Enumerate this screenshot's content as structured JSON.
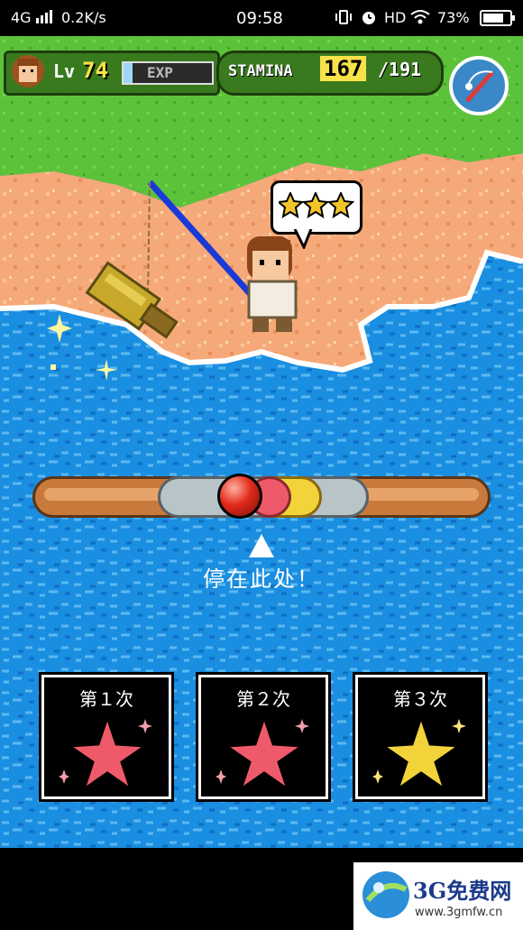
{
  "status_bar": {
    "network": "4G",
    "speed": "0.2K/s",
    "time": "09:58",
    "hd": "HD",
    "battery": "73%"
  },
  "hud": {
    "level_prefix": "Lv",
    "level": "74",
    "exp_label": "EXP",
    "exp_progress": 0.1,
    "stamina_label": "STAMINA",
    "stamina_current": "167",
    "stamina_max": "/191"
  },
  "speech": {
    "stars": 3
  },
  "meter": {
    "marker_position": 0.45
  },
  "prompt": {
    "text": "停在此处！"
  },
  "attempts": [
    {
      "label": "第１次",
      "star_color": "#ef5a6a"
    },
    {
      "label": "第２次",
      "star_color": "#ef5a6a"
    },
    {
      "label": "第３次",
      "star_color": "#f2d43a"
    }
  ],
  "watermark": {
    "title": "3G免费网",
    "url": "www.3gmfw.cn"
  },
  "colors": {
    "grass": "#5cc23a",
    "sand": "#f6a978",
    "water": "#1a8ee0",
    "hud_green": "#3a7a1f"
  }
}
